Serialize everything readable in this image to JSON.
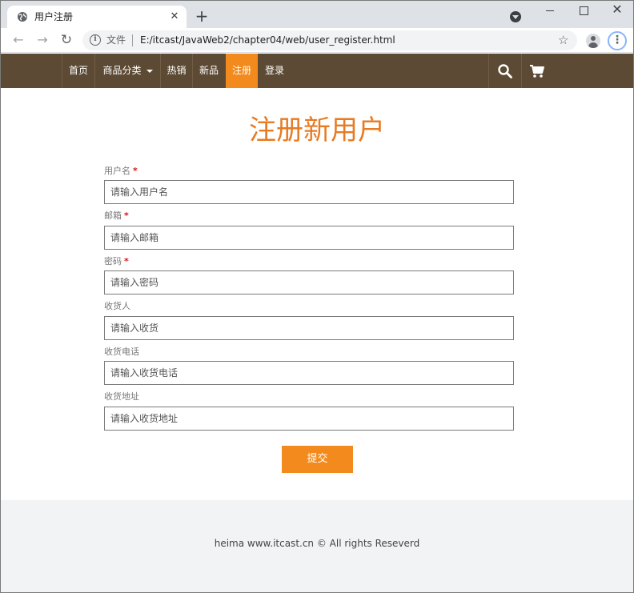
{
  "browser": {
    "tab_title": "用户注册",
    "tab_close": "✕",
    "new_tab": "+",
    "window_close": "✕",
    "address_label": "文件",
    "url": "E:/itcast/JavaWeb2/chapter04/web/user_register.html",
    "back": "←",
    "forward": "→",
    "reload": "↻",
    "star": "☆",
    "menu": "⋮"
  },
  "nav": {
    "items": [
      {
        "label": "首页"
      },
      {
        "label": "商品分类"
      },
      {
        "label": "热销"
      },
      {
        "label": "新品"
      },
      {
        "label": "注册"
      },
      {
        "label": "登录"
      }
    ],
    "active_index": 4
  },
  "form": {
    "title": "注册新用户",
    "required_mark": "*",
    "fields": [
      {
        "label": "用户名",
        "placeholder": "请输入用户名",
        "required": true
      },
      {
        "label": "邮箱",
        "placeholder": "请输入邮箱",
        "required": true
      },
      {
        "label": "密码",
        "placeholder": "请输入密码",
        "required": true
      },
      {
        "label": "收货人",
        "placeholder": "请输入收货",
        "required": false
      },
      {
        "label": "收货电话",
        "placeholder": "请输入收货电话",
        "required": false
      },
      {
        "label": "收货地址",
        "placeholder": "请输入收货地址",
        "required": false
      }
    ],
    "submit_label": "提交"
  },
  "footer": {
    "text": "heima www.itcast.cn © All rights Reseverd"
  },
  "colors": {
    "nav_bg": "#5d4a35",
    "accent": "#f28a1d",
    "title": "#e87a22",
    "footer_bg": "#f1f3f4"
  }
}
